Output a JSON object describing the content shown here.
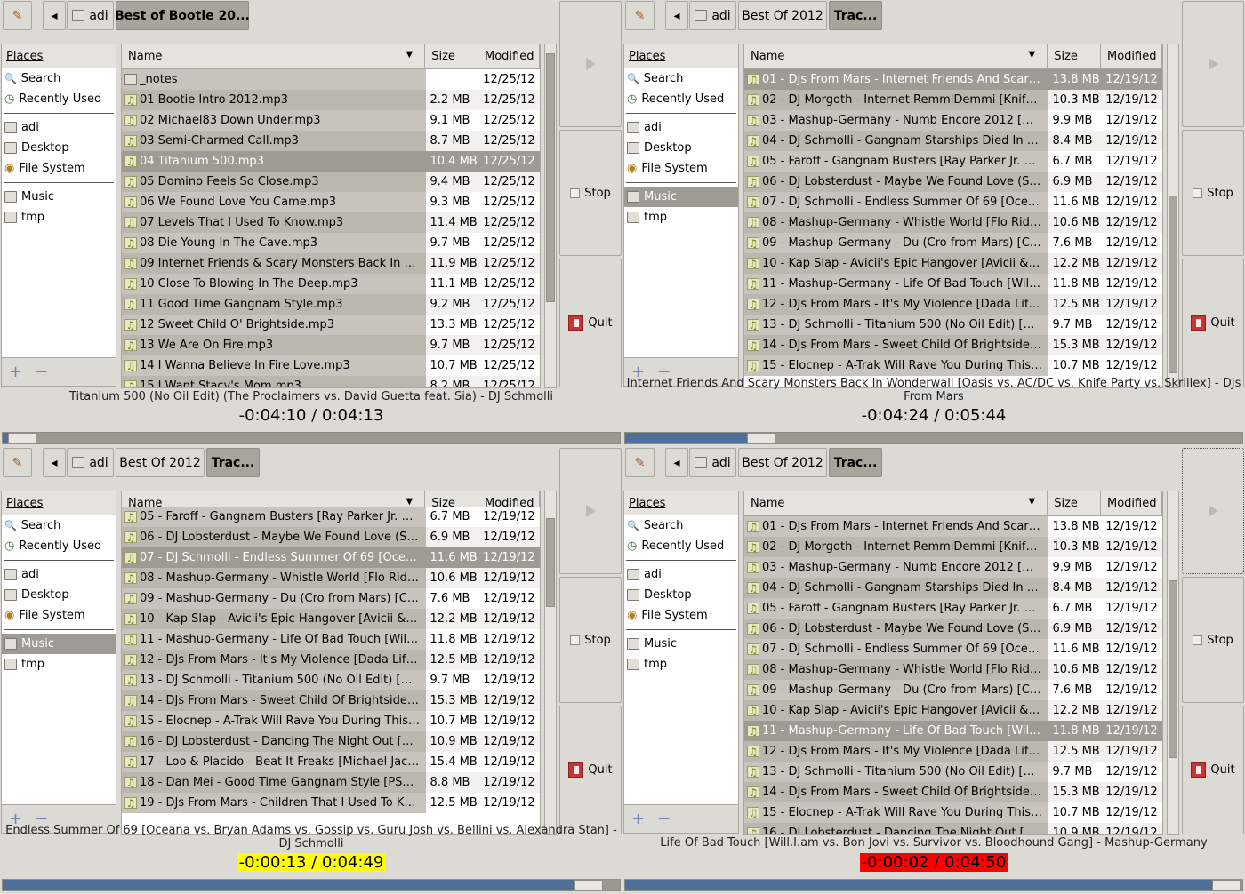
{
  "common": {
    "places_header": "Places",
    "name_header": "Name",
    "size_header": "Size",
    "modified_header": "Modified",
    "stop_label": "Stop",
    "quit_label": "Quit",
    "sort_glyph": "▼",
    "back_glyph": "◂",
    "add_glyph": "+",
    "remove_glyph": "−",
    "note_glyph": "♫",
    "play_glyph": "▷"
  },
  "panels": [
    {
      "path": [
        "adi",
        "Best of Bootie 20..."
      ],
      "places": [
        "Search",
        "Recently Used",
        "adi",
        "Desktop",
        "File System",
        "Music",
        "tmp"
      ],
      "selected_place": -1,
      "rows": [
        [
          "_notes",
          "",
          "12/25/12",
          "folder"
        ],
        [
          "01 Bootie Intro 2012.mp3",
          "2.2 MB",
          "12/25/12",
          "note"
        ],
        [
          "02 Michael83 Down Under.mp3",
          "9.1 MB",
          "12/25/12",
          "note"
        ],
        [
          "03 Semi-Charmed Call.mp3",
          "8.7 MB",
          "12/25/12",
          "note"
        ],
        [
          "04 Titanium 500.mp3",
          "10.4 MB",
          "12/25/12",
          "note"
        ],
        [
          "05 Domino Feels So Close.mp3",
          "9.4 MB",
          "12/25/12",
          "note"
        ],
        [
          "06 We Found Love You Came.mp3",
          "9.3 MB",
          "12/25/12",
          "note"
        ],
        [
          "07 Levels That I Used To Know.mp3",
          "11.4 MB",
          "12/25/12",
          "note"
        ],
        [
          "08 Die Young In The Cave.mp3",
          "9.7 MB",
          "12/25/12",
          "note"
        ],
        [
          "09 Internet Friends & Scary Monsters Back In W...",
          "11.9 MB",
          "12/25/12",
          "note"
        ],
        [
          "10 Close To Blowing In The Deep.mp3",
          "11.1 MB",
          "12/25/12",
          "note"
        ],
        [
          "11 Good Time Gangnam Style.mp3",
          "9.2 MB",
          "12/25/12",
          "note"
        ],
        [
          "12 Sweet Child O' Brightside.mp3",
          "13.3 MB",
          "12/25/12",
          "note"
        ],
        [
          "13 We Are On Fire.mp3",
          "9.7 MB",
          "12/25/12",
          "note"
        ],
        [
          "14 I Wanna Believe In Fire Love.mp3",
          "10.7 MB",
          "12/25/12",
          "note"
        ],
        [
          "15 I Want Stacy's Mom.mp3",
          "8.2 MB",
          "12/25/12",
          "note"
        ]
      ],
      "selected_row": 4,
      "info": "Titanium 500 (No Oil Edit) (The Proclaimers vs. David Guetta feat. Sia) - DJ Schmolli",
      "time": "-0:04:10 / 0:04:13",
      "time_bg": "",
      "progress": 0.01
    },
    {
      "path": [
        "adi",
        "Best Of 2012",
        "Trac..."
      ],
      "places": [
        "Search",
        "Recently Used",
        "adi",
        "Desktop",
        "File System",
        "Music",
        "tmp"
      ],
      "selected_place": 5,
      "rows": [
        [
          "01 - DJs From Mars - Internet Friends And Scary...",
          "13.8 MB",
          "12/19/12",
          "note"
        ],
        [
          "02 - DJ Morgoth - Internet RemmiDemmi [Knife ...",
          "10.3 MB",
          "12/19/12",
          "note"
        ],
        [
          "03 - Mashup-Germany - Numb Encore 2012 [Mi...",
          "9.9 MB",
          "12/19/12",
          "note"
        ],
        [
          "04 - DJ Schmolli - Gangnam Starships Died In Z...",
          "8.4 MB",
          "12/19/12",
          "note"
        ],
        [
          "05 - Faroff - Gangnam Busters [Ray Parker Jr. vs...",
          "6.7 MB",
          "12/19/12",
          "note"
        ],
        [
          "06 - DJ Lobsterdust - Maybe We Found Love (So...",
          "6.9 MB",
          "12/19/12",
          "note"
        ],
        [
          "07 - DJ Schmolli - Endless Summer Of 69 [Ocea...",
          "11.6 MB",
          "12/19/12",
          "note"
        ],
        [
          "08 - Mashup-Germany - Whistle World [Flo Rida ...",
          "10.6 MB",
          "12/19/12",
          "note"
        ],
        [
          "09 - Mashup-Germany - Du (Cro from Mars) [Cr...",
          "7.6 MB",
          "12/19/12",
          "note"
        ],
        [
          "10 - Kap Slap - Avicii's Epic Hangover [Avicii & ...",
          "12.2 MB",
          "12/19/12",
          "note"
        ],
        [
          "11 - Mashup-Germany - Life Of Bad Touch [Will.I...",
          "11.8 MB",
          "12/19/12",
          "note"
        ],
        [
          "12 - DJs From Mars - It's My Violence [Dada Life...",
          "12.5 MB",
          "12/19/12",
          "note"
        ],
        [
          "13 - DJ Schmolli - Titanium 500 (No Oil Edit) [Da...",
          "9.7 MB",
          "12/19/12",
          "note"
        ],
        [
          "14 - DJs From Mars - Sweet Child Of Brightside [...",
          "15.3 MB",
          "12/19/12",
          "note"
        ],
        [
          "15 - Elocnep - A-Trak Will Rave You During This ...",
          "10.7 MB",
          "12/19/12",
          "note"
        ]
      ],
      "selected_row": 0,
      "info": "Internet Friends And Scary Monsters Back In Wonderwall [Oasis vs. AC/DC vs. Knife Party vs. Skrillex] - DJs From Mars",
      "time": "-0:04:24 / 0:05:44",
      "time_bg": "",
      "progress": 0.22
    },
    {
      "path": [
        "adi",
        "Best Of 2012",
        "Trac..."
      ],
      "places": [
        "Search",
        "Recently Used",
        "adi",
        "Desktop",
        "File System",
        "Music",
        "tmp"
      ],
      "selected_place": 5,
      "rows": [
        [
          "05 - Faroff - Gangnam Busters [Ray Parker Jr. vs...",
          "6.7 MB",
          "12/19/12",
          "note"
        ],
        [
          "06 - DJ Lobsterdust - Maybe We Found Love (So...",
          "6.9 MB",
          "12/19/12",
          "note"
        ],
        [
          "07 - DJ Schmolli - Endless Summer Of 69 [Ocea...",
          "11.6 MB",
          "12/19/12",
          "note"
        ],
        [
          "08 - Mashup-Germany - Whistle World [Flo Rida ...",
          "10.6 MB",
          "12/19/12",
          "note"
        ],
        [
          "09 - Mashup-Germany - Du (Cro from Mars) [Cr...",
          "7.6 MB",
          "12/19/12",
          "note"
        ],
        [
          "10 - Kap Slap - Avicii's Epic Hangover [Avicii & ...",
          "12.2 MB",
          "12/19/12",
          "note"
        ],
        [
          "11 - Mashup-Germany - Life Of Bad Touch [Will.I...",
          "11.8 MB",
          "12/19/12",
          "note"
        ],
        [
          "12 - DJs From Mars - It's My Violence [Dada Life...",
          "12.5 MB",
          "12/19/12",
          "note"
        ],
        [
          "13 - DJ Schmolli - Titanium 500 (No Oil Edit) [Da...",
          "9.7 MB",
          "12/19/12",
          "note"
        ],
        [
          "14 - DJs From Mars - Sweet Child Of Brightside [...",
          "15.3 MB",
          "12/19/12",
          "note"
        ],
        [
          "15 - Elocnep - A-Trak Will Rave You During This ...",
          "10.7 MB",
          "12/19/12",
          "note"
        ],
        [
          "16 - DJ Lobsterdust - Dancing The Night Out [M...",
          "10.9 MB",
          "12/19/12",
          "note"
        ],
        [
          "17 - Loo & Placido - Beat It Freaks [Michael Jack...",
          "15.4 MB",
          "12/19/12",
          "note"
        ],
        [
          "18 - Dan Mei - Good Time Gangnam Style [PSY ...",
          "8.8 MB",
          "12/19/12",
          "note"
        ],
        [
          "19 - DJs From Mars - Children That I Used To Kn...",
          "12.5 MB",
          "12/19/12",
          "note"
        ]
      ],
      "selected_row": 2,
      "info": "Endless Summer Of 69 [Oceana vs. Bryan Adams vs. Gossip vs. Guru Josh vs. Bellini vs. Alexandra Stan] - DJ Schmolli",
      "time": "-0:00:13 / 0:04:49",
      "time_bg": "#ffff00",
      "progress": 0.95
    },
    {
      "path": [
        "adi",
        "Best Of 2012",
        "Trac..."
      ],
      "places": [
        "Search",
        "Recently Used",
        "adi",
        "Desktop",
        "File System",
        "Music",
        "tmp"
      ],
      "selected_place": -1,
      "rows": [
        [
          "01 - DJs From Mars - Internet Friends And Scary...",
          "13.8 MB",
          "12/19/12",
          "note"
        ],
        [
          "02 - DJ Morgoth - Internet RemmiDemmi [Knife ...",
          "10.3 MB",
          "12/19/12",
          "note"
        ],
        [
          "03 - Mashup-Germany - Numb Encore 2012 [Mi...",
          "9.9 MB",
          "12/19/12",
          "note"
        ],
        [
          "04 - DJ Schmolli - Gangnam Starships Died In Z...",
          "8.4 MB",
          "12/19/12",
          "note"
        ],
        [
          "05 - Faroff - Gangnam Busters [Ray Parker Jr. vs...",
          "6.7 MB",
          "12/19/12",
          "note"
        ],
        [
          "06 - DJ Lobsterdust - Maybe We Found Love (So...",
          "6.9 MB",
          "12/19/12",
          "note"
        ],
        [
          "07 - DJ Schmolli - Endless Summer Of 69 [Ocea...",
          "11.6 MB",
          "12/19/12",
          "note"
        ],
        [
          "08 - Mashup-Germany - Whistle World [Flo Rida ...",
          "10.6 MB",
          "12/19/12",
          "note"
        ],
        [
          "09 - Mashup-Germany - Du (Cro from Mars) [Cr...",
          "7.6 MB",
          "12/19/12",
          "note"
        ],
        [
          "10 - Kap Slap - Avicii's Epic Hangover [Avicii & ...",
          "12.2 MB",
          "12/19/12",
          "note"
        ],
        [
          "11 - Mashup-Germany - Life Of Bad Touch [Will.I...",
          "11.8 MB",
          "12/19/12",
          "note"
        ],
        [
          "12 - DJs From Mars - It's My Violence [Dada Life...",
          "12.5 MB",
          "12/19/12",
          "note"
        ],
        [
          "13 - DJ Schmolli - Titanium 500 (No Oil Edit) [Da...",
          "9.7 MB",
          "12/19/12",
          "note"
        ],
        [
          "14 - DJs From Mars - Sweet Child Of Brightside [...",
          "15.3 MB",
          "12/19/12",
          "note"
        ],
        [
          "15 - Elocnep - A-Trak Will Rave You During This ...",
          "10.7 MB",
          "12/19/12",
          "note"
        ],
        [
          "16 - DJ Lobsterdust - Dancing The Night Out [M...",
          "10.9 MB",
          "12/19/12",
          "note"
        ]
      ],
      "selected_row": 10,
      "info": "Life Of Bad Touch [Will.I.am vs. Bon Jovi vs. Survivor vs. Bloodhound Gang] - Mashup-Germany",
      "time": "-0:00:02 / 0:04:50",
      "time_bg": "#ff0000",
      "progress": 0.99
    }
  ]
}
